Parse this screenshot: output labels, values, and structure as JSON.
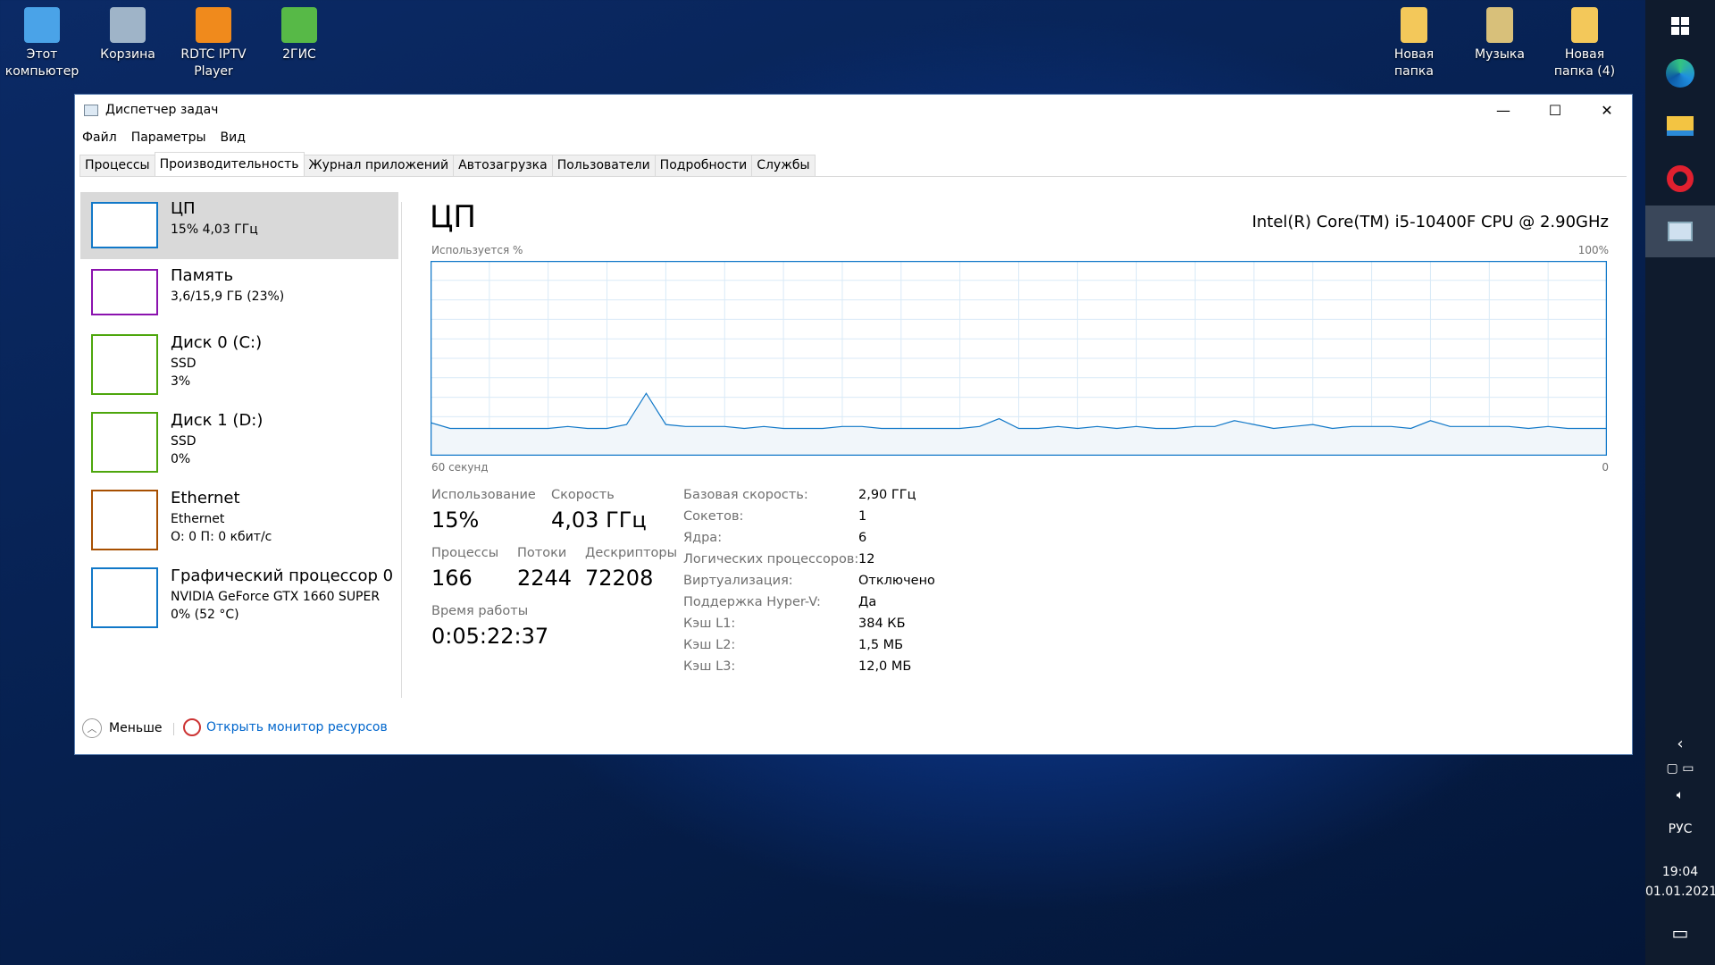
{
  "desktop": {
    "left_icons": [
      {
        "label": "Этот компьютер",
        "icon": "computer-icon",
        "color": "#4aa3e8"
      },
      {
        "label": "Корзина",
        "icon": "recycle-bin-icon",
        "color": "#9fb4c8"
      },
      {
        "label": "RDTC IPTV Player",
        "icon": "iptv-player-icon",
        "color": "#f08a1c"
      },
      {
        "label": "2ГИС",
        "icon": "2gis-icon",
        "color": "#57b947"
      }
    ],
    "right_icons": [
      {
        "label": "Новая папка",
        "icon": "folder-icon",
        "color": "#f3c85a"
      },
      {
        "label": "Музыка",
        "icon": "music-folder-icon",
        "color": "#d8c07a"
      },
      {
        "label": "Новая папка (4)",
        "icon": "folder-icon",
        "color": "#f3c85a"
      }
    ]
  },
  "taskbar": {
    "language": "РУС",
    "time": "19:04",
    "date": "01.01.2021",
    "apps": [
      "windows-start-icon",
      "edge-icon",
      "file-explorer-icon",
      "opera-icon",
      "task-manager-icon"
    ]
  },
  "window": {
    "title": "Диспетчер задач",
    "menu": [
      "Файл",
      "Параметры",
      "Вид"
    ],
    "tabs": [
      "Процессы",
      "Производительность",
      "Журнал приложений",
      "Автозагрузка",
      "Пользователи",
      "Подробности",
      "Службы"
    ],
    "active_tab": 1,
    "resources": [
      {
        "name": "ЦП",
        "line1": "15%  4,03 ГГц",
        "line2": "",
        "color": "#1178c8",
        "selected": true
      },
      {
        "name": "Память",
        "line1": "3,6/15,9 ГБ (23%)",
        "line2": "",
        "color": "#8b12ae"
      },
      {
        "name": "Диск 0 (C:)",
        "line1": "SSD",
        "line2": "3%",
        "color": "#4da60c"
      },
      {
        "name": "Диск 1 (D:)",
        "line1": "SSD",
        "line2": "0%",
        "color": "#4da60c"
      },
      {
        "name": "Ethernet",
        "line1": "Ethernet",
        "line2": "О: 0 П: 0 кбит/с",
        "color": "#a74f01"
      },
      {
        "name": "Графический процессор 0",
        "line1": "NVIDIA GeForce GTX 1660 SUPER",
        "line2": "0%  (52 °C)",
        "color": "#1178c8"
      }
    ],
    "detail": {
      "title": "ЦП",
      "cpu_model": "Intel(R) Core(TM) i5-10400F CPU @ 2.90GHz",
      "graph_label": "Используется %",
      "graph_max": "100%",
      "graph_time": "60 секунд",
      "graph_min": "0",
      "stats": {
        "usage_label": "Использование",
        "usage": "15%",
        "speed_label": "Скорость",
        "speed": "4,03 ГГц",
        "proc_label": "Процессы",
        "proc": "166",
        "threads_label": "Потоки",
        "threads": "2244",
        "handles_label": "Дескрипторы",
        "handles": "72208",
        "uptime_label": "Время работы",
        "uptime": "0:05:22:37"
      },
      "specs": [
        [
          "Базовая скорость:",
          "2,90 ГГц"
        ],
        [
          "Сокетов:",
          "1"
        ],
        [
          "Ядра:",
          "6"
        ],
        [
          "Логических процессоров:",
          "12"
        ],
        [
          "Виртуализация:",
          "Отключено"
        ],
        [
          "Поддержка Hyper-V:",
          "Да"
        ],
        [
          "Кэш L1:",
          "384 КБ"
        ],
        [
          "Кэш L2:",
          "1,5 МБ"
        ],
        [
          "Кэш L3:",
          "12,0 МБ"
        ]
      ]
    },
    "footer": {
      "fewer": "Меньше",
      "resource_monitor": "Открыть монитор ресурсов"
    }
  },
  "chart_data": {
    "type": "area",
    "xlabel": "60 секунд",
    "ylabel": "Используется %",
    "ylim": [
      0,
      100
    ],
    "xlim": [
      60,
      0
    ],
    "grid": true,
    "color": "#1178c8",
    "values": [
      17,
      14,
      14,
      14,
      14,
      14,
      14,
      15,
      14,
      14,
      16,
      32,
      16,
      15,
      15,
      15,
      14,
      15,
      14,
      14,
      14,
      15,
      15,
      14,
      14,
      14,
      14,
      14,
      15,
      19,
      14,
      14,
      15,
      14,
      15,
      14,
      15,
      14,
      14,
      15,
      15,
      18,
      16,
      14,
      15,
      16,
      14,
      15,
      15,
      15,
      14,
      18,
      15,
      15,
      15,
      15,
      14,
      15,
      14,
      14,
      14
    ]
  }
}
